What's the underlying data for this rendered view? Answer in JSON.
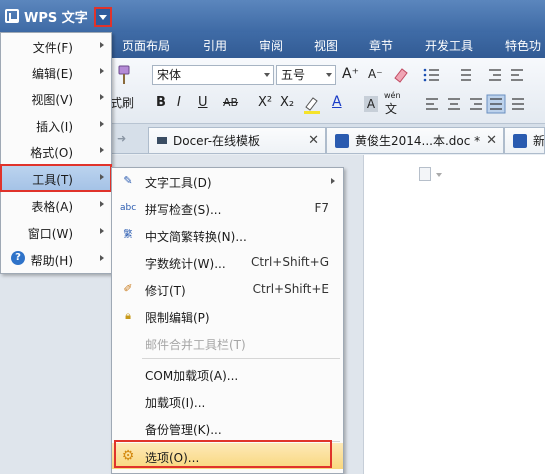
{
  "app": {
    "title": "WPS 文字"
  },
  "ribbon_tabs": [
    "页面布局",
    "引用",
    "审阅",
    "视图",
    "章节",
    "开发工具",
    "特色功"
  ],
  "ribbon": {
    "font_name": "宋体",
    "font_size": "五号",
    "format_painter_label": "式刷",
    "font_buttons": [
      "B",
      "I",
      "U",
      "AB",
      "X²",
      "X₂"
    ],
    "font_grow": "A⁺",
    "font_shrink": "A⁻",
    "text_color_letter": "A",
    "char_shade_letter": "A",
    "pinyin_label": "wén",
    "pinyin_char": "文"
  },
  "doc_tabs": [
    {
      "label": "Docer-在线模板"
    },
    {
      "label": "黄俊生2014...本.doc *"
    },
    {
      "label": "新"
    }
  ],
  "main_menu": [
    {
      "label": "文件(F)",
      "submenu": true
    },
    {
      "label": "编辑(E)",
      "submenu": true
    },
    {
      "label": "视图(V)",
      "submenu": true
    },
    {
      "label": "插入(I)",
      "submenu": true
    },
    {
      "label": "格式(O)",
      "submenu": true
    },
    {
      "label": "工具(T)",
      "submenu": true,
      "active": true
    },
    {
      "label": "表格(A)",
      "submenu": true
    },
    {
      "label": "窗口(W)",
      "submenu": true
    },
    {
      "label": "帮助(H)",
      "submenu": true
    }
  ],
  "tools_menu": {
    "group1": [
      {
        "label": "文字工具(D)",
        "icon": "text-tool-icon",
        "submenu": true
      },
      {
        "label": "拼写检查(S)...",
        "icon": "spell-check-icon",
        "shortcut": "F7"
      },
      {
        "label": "中文简繁转换(N)...",
        "icon": "chinese-convert-icon"
      },
      {
        "label": "字数统计(W)...",
        "shortcut": "Ctrl+Shift+G"
      },
      {
        "label": "修订(T)",
        "icon": "revision-icon",
        "shortcut": "Ctrl+Shift+E"
      },
      {
        "label": "限制编辑(P)",
        "icon": "lock-icon"
      },
      {
        "label": "邮件合并工具栏(T)",
        "disabled": true
      }
    ],
    "group2": [
      {
        "label": "COM加载项(A)..."
      },
      {
        "label": "加载项(I)..."
      },
      {
        "label": "备份管理(K)..."
      }
    ],
    "options": {
      "label": "选项(O)...",
      "icon": "gear-icon"
    }
  },
  "colors": {
    "title_bar": "#3e6aa5",
    "highlight_border": "#e0332b",
    "menu_active": "#a4c2e6",
    "option_active": "#f9d77d"
  }
}
